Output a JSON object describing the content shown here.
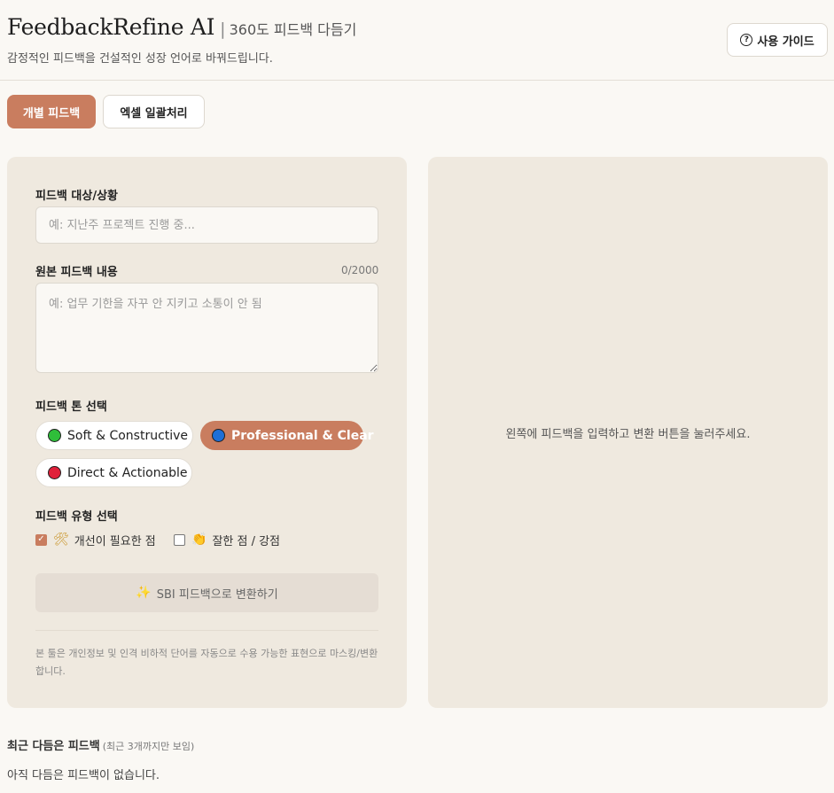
{
  "header": {
    "brand": "FeedbackRefine AI",
    "separator": "|",
    "subtitle": "360도 피드백 다듬기",
    "tagline": "감정적인 피드백을 건설적인 성장 언어로 바꿔드립니다.",
    "guide_label": "사용 가이드",
    "guide_icon": "question-circle-icon"
  },
  "tabs": [
    {
      "label": "개별 피드백",
      "active": true
    },
    {
      "label": "엑셀 일괄처리",
      "active": false
    }
  ],
  "form": {
    "target_label": "피드백 대상/상황",
    "target_placeholder": "예: 지난주 프로젝트 진행 중...",
    "target_value": "",
    "content_label": "원본 피드백 내용",
    "content_counter": "0/2000",
    "content_placeholder": "예: 업무 기한을 자꾸 안 지키고 소통이 안 됨",
    "content_value": "",
    "tone_label": "피드백 톤 선택",
    "tones": [
      {
        "label": "Soft & Constructive",
        "color": "#2fbe3a",
        "selected": false
      },
      {
        "label": "Professional & Clear",
        "color": "#1f6fd6",
        "selected": true
      },
      {
        "label": "Direct & Actionable",
        "color": "#e0203a",
        "selected": false
      }
    ],
    "type_label": "피드백 유형 선택",
    "types": [
      {
        "label": "개선이 필요한 점",
        "checked": true,
        "icon": "🛠"
      },
      {
        "label": "잘한 점 / 강점",
        "checked": false,
        "icon": "👏"
      }
    ],
    "submit_icon": "✨",
    "submit_label": "SBI 피드백으로 변환하기",
    "disclaimer": "본 툴은 개인정보 및 인격 비하적 단어를 자동으로 수용 가능한 표현으로 마스킹/변환합니다."
  },
  "result": {
    "empty_message": "왼쪽에 피드백을 입력하고 변환 버튼을 눌러주세요."
  },
  "recent": {
    "title": "최근 다듬은 피드백",
    "note": "(최근 3개까지만 보임)",
    "empty": "아직 다듬은 피드백이 없습니다."
  },
  "colors": {
    "accent": "#c97d5f",
    "panel_bg": "#efe9df",
    "page_bg": "#faf8f4"
  }
}
